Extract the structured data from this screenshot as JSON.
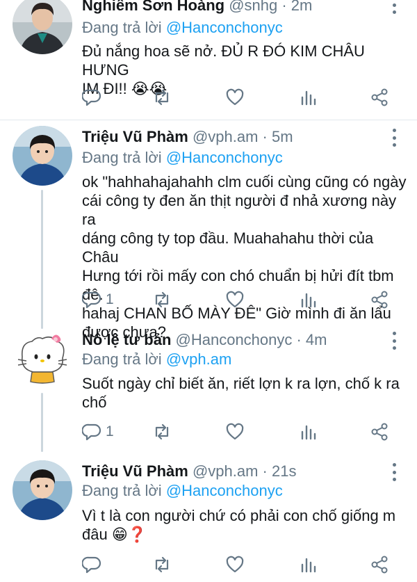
{
  "tweets": [
    {
      "name": "Nghiêm Sơn Hoàng",
      "meta": "@snhg · 2m",
      "reply_prefix": "Đang trả lời",
      "reply_to": "@Hanconchonyc",
      "text": "Đủ nắng hoa sẽ nở. ĐỦ R ĐÓ KIM CHÂU HƯNG\nIM ĐI!! 😭😭",
      "reply_count": "",
      "avatar": "young-man-photo"
    },
    {
      "name": "Triệu Vũ Phàm",
      "meta": "@vph.am · 5m",
      "reply_prefix": "Đang trả lời",
      "reply_to": "@Hanconchonyc",
      "text": "ok \"hahhahajahahh clm cuối cùng cũng có ngày\ncái công ty đen ăn thịt người đ nhả xương này ra\ndáng công ty top đầu. Muahahahu thời của Châu\nHưng tới rồi mấy con chó chuẩn bị hửi đít tbm đê.\nhahaj CHAN BỐ MÀY ĐÊ\" Giờ mình đi ăn lẩu\nđược chưa?",
      "reply_count": "1",
      "avatar": "boy-photo"
    },
    {
      "name": "Nô lệ tư bản",
      "meta": "@Hanconchonyc · 4m",
      "reply_prefix": "Đang trả lời",
      "reply_to": "@vph.am",
      "text": "Suốt ngày chỉ biết ăn, riết lợn k ra lợn, chố k ra\nchố",
      "reply_count": "1",
      "avatar": "hello-kitty-drawing"
    },
    {
      "name": "Triệu Vũ Phàm",
      "meta": "@vph.am · 21s",
      "reply_prefix": "Đang trả lời",
      "reply_to": "@Hanconchonyc",
      "text": "Vì t là con người chứ có phải con chố giống m\nđâu 😁❓",
      "reply_count": "",
      "avatar": "boy-photo"
    }
  ],
  "icons": {
    "reply": "reply-icon",
    "retweet": "retweet-icon",
    "like": "like-icon",
    "stats": "stats-icon",
    "share": "share-icon",
    "more": "more-icon"
  },
  "colors": {
    "link": "#1da1f2",
    "muted": "#657786",
    "text": "#14171a",
    "divider": "#e1e8ed",
    "thread": "#ccd6dd"
  }
}
